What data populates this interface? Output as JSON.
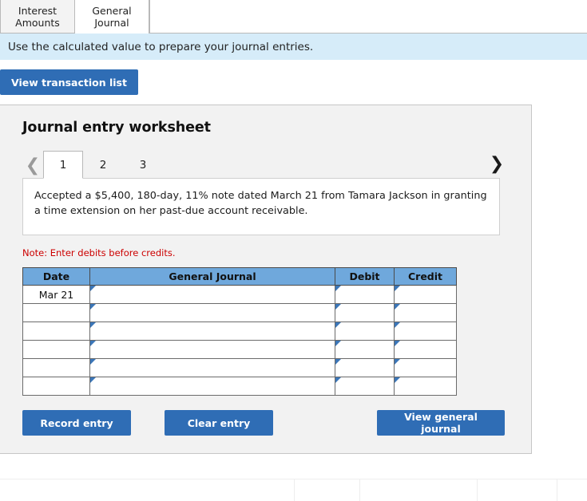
{
  "tabs": [
    {
      "id": "interest-amounts",
      "line1": "Interest",
      "line2": "Amounts",
      "active": false
    },
    {
      "id": "general-journal",
      "line1": "General",
      "line2": "Journal",
      "active": true
    }
  ],
  "banner": {
    "text": "Use the calculated value to prepare your journal entries."
  },
  "toolbar": {
    "view_transaction_list_label": "View transaction list"
  },
  "worksheet": {
    "title": "Journal entry worksheet",
    "pager": {
      "prev_icon": "chevron-left-icon",
      "next_icon": "chevron-right-icon",
      "pages": [
        "1",
        "2",
        "3"
      ],
      "active_page": "1"
    },
    "description": "Accepted a $5,400, 180-day, 11% note dated March 21 from Tamara Jackson in granting a time extension on her past-due account receivable.",
    "note": "Note: Enter debits before credits.",
    "table": {
      "headers": [
        "Date",
        "General Journal",
        "Debit",
        "Credit"
      ],
      "rows": [
        {
          "date": "Mar 21",
          "account": "",
          "debit": "",
          "credit": ""
        },
        {
          "date": "",
          "account": "",
          "debit": "",
          "credit": ""
        },
        {
          "date": "",
          "account": "",
          "debit": "",
          "credit": ""
        },
        {
          "date": "",
          "account": "",
          "debit": "",
          "credit": ""
        },
        {
          "date": "",
          "account": "",
          "debit": "",
          "credit": ""
        },
        {
          "date": "",
          "account": "",
          "debit": "",
          "credit": ""
        }
      ]
    },
    "actions": {
      "record_label": "Record entry",
      "clear_label": "Clear entry",
      "view_general_journal_label": "View general journal"
    }
  },
  "colors": {
    "button_blue": "#2f6db5",
    "header_blue": "#6fa8dc",
    "cell_border_blue": "#3b76b8",
    "banner_blue": "#d6ecf9",
    "note_red": "#cc0000",
    "panel_grey": "#f2f2f2"
  }
}
